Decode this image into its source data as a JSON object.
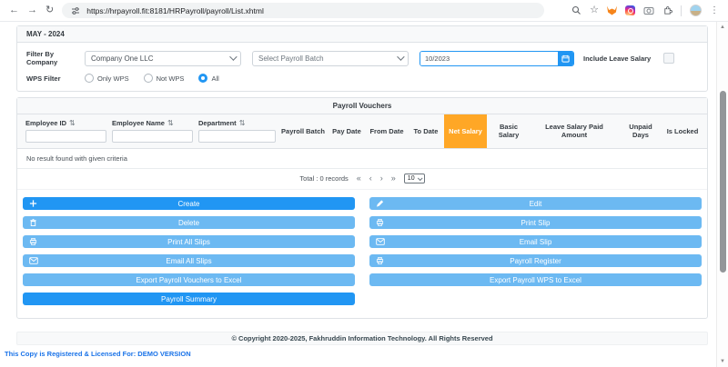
{
  "browser": {
    "url": "https://hrpayroll.fit:8181/HRPayroll/payroll/List.xhtml",
    "icon_glyphs": {
      "back": "←",
      "forward": "→",
      "reload": "↻",
      "star": "☆",
      "menu": "⋮"
    },
    "extension_icons": [
      "metamask-icon",
      "instagram-icon",
      "camera-icon",
      "extensions-puzzle-icon"
    ]
  },
  "scrollbar": {
    "up": "▲",
    "down": "▼"
  },
  "period_header": "MAY - 2024",
  "filters": {
    "company_label": "Filter By Company",
    "company_value": "Company One LLC",
    "batch_value": "Select Payroll Batch",
    "period_value": "10/2023",
    "include_leave_salary_label": "Include Leave Salary",
    "include_leave_salary_checked": false,
    "wps_filter_label": "WPS Filter",
    "wps_options": [
      {
        "label": "Only WPS",
        "selected": false
      },
      {
        "label": "Not WPS",
        "selected": false
      },
      {
        "label": "All",
        "selected": true
      }
    ]
  },
  "vouchers": {
    "title": "Payroll Vouchers",
    "sort_glyph": "⇅",
    "columns": [
      {
        "label": "Employee ID",
        "sortable": true,
        "filter": true
      },
      {
        "label": "Employee Name",
        "sortable": true,
        "filter": true
      },
      {
        "label": "Department",
        "sortable": true,
        "filter": true
      },
      {
        "label": "Payroll Batch"
      },
      {
        "label": "Pay Date"
      },
      {
        "label": "From Date"
      },
      {
        "label": "To Date"
      },
      {
        "label": "Net Salary",
        "highlighted": true,
        "highlight_color": "#FFA726"
      },
      {
        "label": "Basic Salary"
      },
      {
        "label": "Leave Salary Paid Amount"
      },
      {
        "label": "Unpaid Days"
      },
      {
        "label": "Is Locked"
      }
    ],
    "empty_message": "No result found with given criteria",
    "paginator": {
      "total_label": "Total : 0 records",
      "first": "«",
      "prev": "‹",
      "next": "›",
      "last": "»",
      "page_size": "10"
    }
  },
  "actions": {
    "left": [
      {
        "label": "Create",
        "icon": "plus-icon",
        "primary": true
      },
      {
        "label": "Delete",
        "icon": "trash-icon"
      },
      {
        "label": "Print All Slips",
        "icon": "printer-icon"
      },
      {
        "label": "Email All Slips",
        "icon": "envelope-icon"
      },
      {
        "label": "Export Payroll Vouchers to Excel"
      },
      {
        "label": "Payroll Summary",
        "primary": true
      }
    ],
    "right": [
      {
        "label": "Edit",
        "icon": "pencil-icon"
      },
      {
        "label": "Print Slip",
        "icon": "printer-icon"
      },
      {
        "label": "Email Slip",
        "icon": "envelope-icon"
      },
      {
        "label": "Payroll Register",
        "icon": "printer-icon"
      },
      {
        "label": "Export Payroll WPS to Excel"
      }
    ]
  },
  "footer": "© Copyright 2020-2025, Fakhruddin Information Technology. All Rights Reserved",
  "license_text": "This Copy is Registered & Licensed For: DEMO VERSION",
  "colors": {
    "primary": "#2196F3",
    "light_button": "#6CB9F2",
    "highlight": "#FFA726",
    "license_blue": "#1a73e8"
  }
}
